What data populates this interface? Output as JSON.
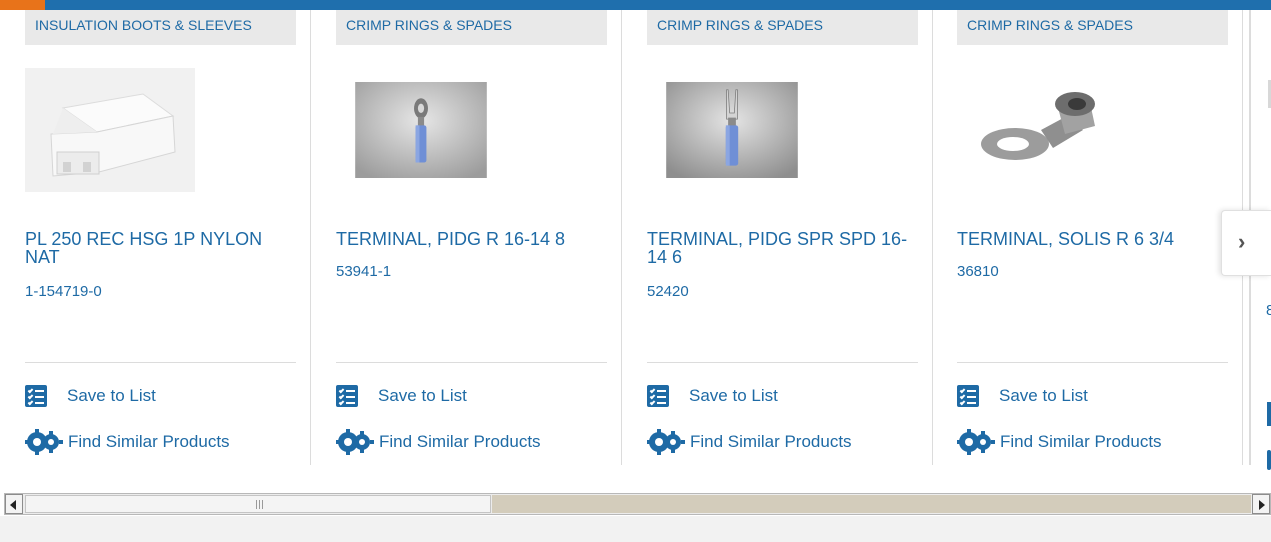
{
  "products": [
    {
      "category": "INSULATION BOOTS & SLEEVES",
      "title": "PL 250 REC HSG 1P NYLON NAT",
      "part_number": "1-154719-0",
      "image": "nylon-receptacle-housing"
    },
    {
      "category": "CRIMP RINGS & SPADES",
      "title": "TERMINAL, PIDG R 16-14 8",
      "part_number": "53941-1",
      "image": "ring-terminal-blue"
    },
    {
      "category": "CRIMP RINGS & SPADES",
      "title": "TERMINAL, PIDG SPR SPD 16-14 6",
      "part_number": "52420",
      "image": "spade-terminal-blue"
    },
    {
      "category": "CRIMP RINGS & SPADES",
      "title": "TERMINAL, SOLIS R 6 3/4",
      "part_number": "36810",
      "image": "ring-terminal-uninsulated"
    }
  ],
  "actions": {
    "save_label": "Save to List",
    "find_label": "Find Similar Products",
    "save_icon": "list-check-icon",
    "find_icon": "gears-icon"
  },
  "carousel": {
    "next_icon": "chevron-right-icon",
    "partial_card_part_prefix": "8"
  },
  "colors": {
    "link": "#1e6aa5",
    "top_bar": "#1f6fad",
    "top_bar_accent": "#e8731a",
    "category_bg": "#e9e9e9"
  }
}
